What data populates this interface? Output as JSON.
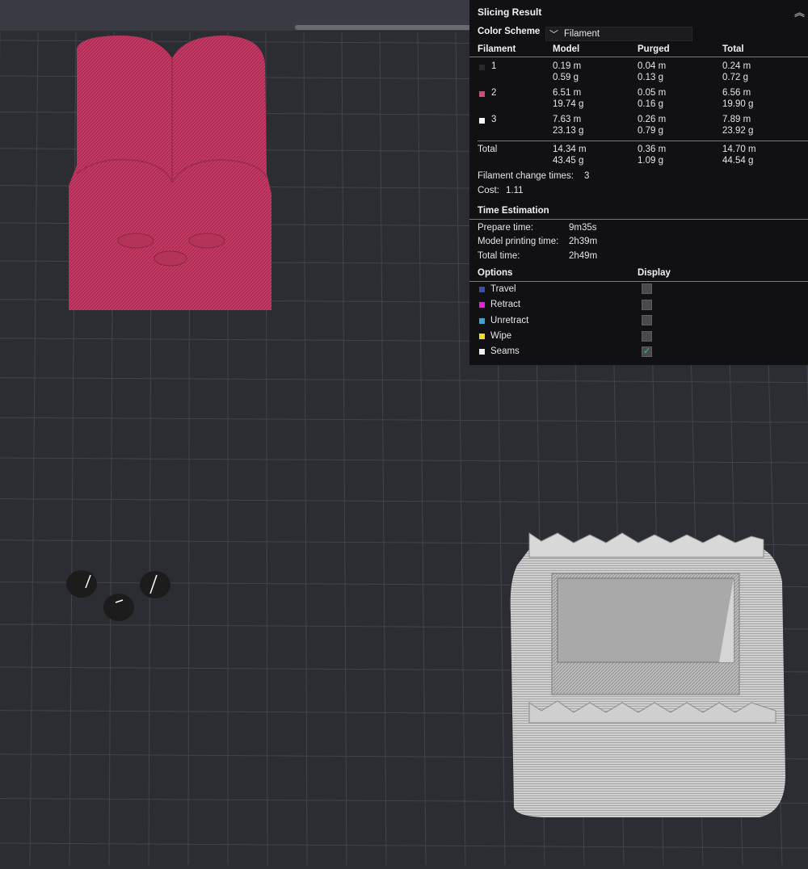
{
  "panel": {
    "title": "Slicing Result",
    "collapse_icon": "chevron-up-icon",
    "color_scheme_label": "Color Scheme",
    "color_scheme_value": "Filament",
    "filament_table": {
      "headers": [
        "Filament",
        "Model",
        "Purged",
        "Total"
      ],
      "rows": [
        {
          "id": "1",
          "swatch": "#2a2a2a",
          "model_len": "0.19 m",
          "model_wt": "0.59 g",
          "purged_len": "0.04 m",
          "purged_wt": "0.13 g",
          "total_len": "0.24 m",
          "total_wt": "0.72 g"
        },
        {
          "id": "2",
          "swatch": "#e0457a",
          "model_len": "6.51 m",
          "model_wt": "19.74 g",
          "purged_len": "0.05 m",
          "purged_wt": "0.16 g",
          "total_len": "6.56 m",
          "total_wt": "19.90 g"
        },
        {
          "id": "3",
          "swatch": "#ffffff",
          "model_len": "7.63 m",
          "model_wt": "23.13 g",
          "purged_len": "0.26 m",
          "purged_wt": "0.79 g",
          "total_len": "7.89 m",
          "total_wt": "23.92 g"
        }
      ],
      "total": {
        "label": "Total",
        "model_len": "14.34 m",
        "model_wt": "43.45 g",
        "purged_len": "0.36 m",
        "purged_wt": "1.09 g",
        "total_len": "14.70 m",
        "total_wt": "44.54 g"
      }
    },
    "filament_change_label": "Filament change times:",
    "filament_change_value": "3",
    "cost_label": "Cost:",
    "cost_value": "1.11",
    "time_estimation": {
      "title": "Time Estimation",
      "prepare_label": "Prepare time:",
      "prepare_value": "9m35s",
      "model_label": "Model printing time:",
      "model_value": "2h39m",
      "total_label": "Total time:",
      "total_value": "2h49m"
    },
    "options": {
      "header": "Options",
      "display_header": "Display",
      "items": [
        {
          "label": "Travel",
          "color": "#3a4fb0",
          "checked": false
        },
        {
          "label": "Retract",
          "color": "#d92bd0",
          "checked": false
        },
        {
          "label": "Unretract",
          "color": "#3aa6cc",
          "checked": false
        },
        {
          "label": "Wipe",
          "color": "#f2e01e",
          "checked": false
        },
        {
          "label": "Seams",
          "color": "#f0f0f0",
          "checked": true
        }
      ]
    }
  },
  "colors": {
    "plate": "#2c2c33",
    "grid": "#43434b",
    "filament_2": "#c43a64",
    "filament_3": "#c9c9c9",
    "filament_1": "#1e1e1e"
  }
}
